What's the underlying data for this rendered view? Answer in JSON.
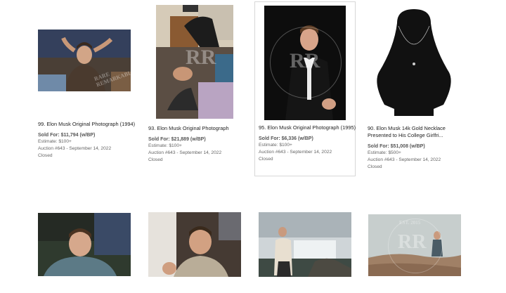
{
  "lots": [
    {
      "title": "99. Elon Musk Original Photograph (1994)",
      "sold": "Sold For: $11,794 (w/BP)",
      "estimate": "Estimate: $100+",
      "auction": "Auction #643 - September 14, 2022",
      "status": "Closed"
    },
    {
      "title": "93. Elon Musk Original Photograph",
      "sold": "Sold For: $21,889 (w/BP)",
      "estimate": "Estimate: $100+",
      "auction": "Auction #643 - September 14, 2022",
      "status": "Closed"
    },
    {
      "title": "95. Elon Musk Original Photograph (1995)",
      "sold": "Sold For: $6,336 (w/BP)",
      "estimate": "Estimate: $100+",
      "auction": "Auction #643 - September 14, 2022",
      "status": "Closed"
    },
    {
      "title": "90. Elon Musk 14k Gold Necklace Presented to His College Girlfri...",
      "sold": "Sold For: $51,008 (w/BP)",
      "estimate": "Estimate: $500+",
      "auction": "Auction #643 - September 14, 2022",
      "status": "Closed"
    }
  ],
  "watermark": {
    "letters": "RR",
    "ring_text": "RARE REMARKABLE",
    "est": "EST. 2015"
  },
  "colors": {
    "card_border": "#d7d7d7",
    "text": "#222222",
    "muted": "#666666"
  }
}
